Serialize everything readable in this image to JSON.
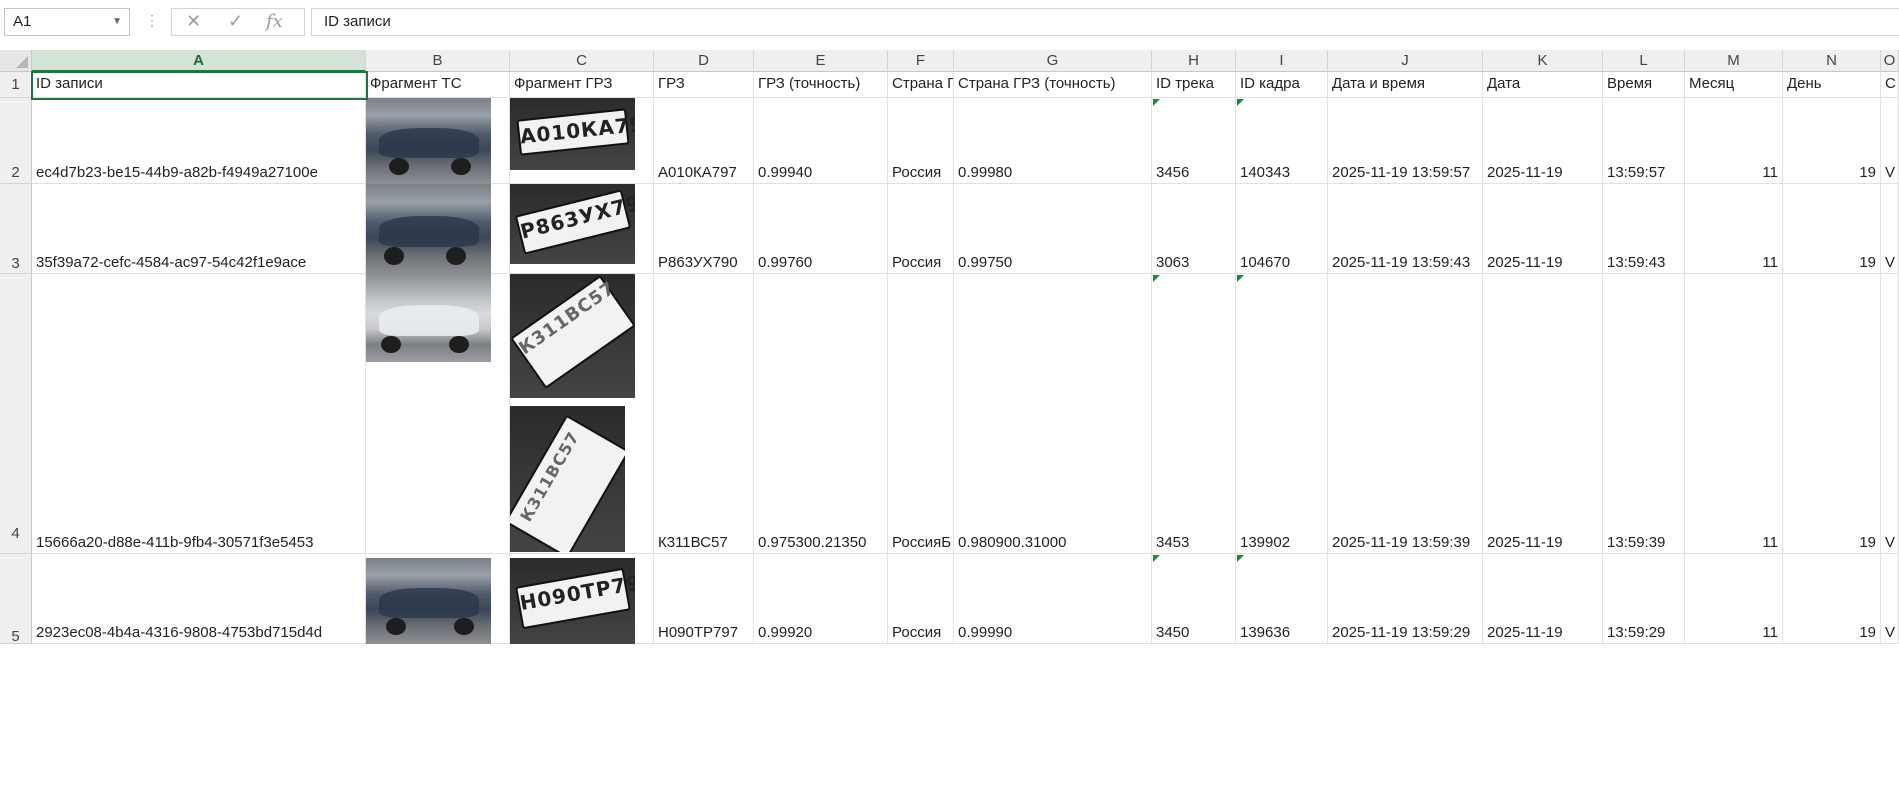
{
  "formula_bar": {
    "name_box": "A1",
    "fx_label": "fx",
    "cancel_glyph": "✕",
    "enter_glyph": "✓",
    "formula_value": "ID записи"
  },
  "columns": [
    "A",
    "B",
    "C",
    "D",
    "E",
    "F",
    "G",
    "H",
    "I",
    "J",
    "K",
    "L",
    "M",
    "N",
    "O"
  ],
  "row_numbers": [
    "1",
    "2",
    "3",
    "4",
    "5"
  ],
  "headers": {
    "A": "ID записи",
    "B": "Фрагмент ТС",
    "C": "Фрагмент ГРЗ",
    "D": "ГРЗ",
    "E": "ГРЗ (точность)",
    "F": "Страна ГРЗ",
    "G": "Страна ГРЗ (точность)",
    "H": "ID трека",
    "I": "ID кадра",
    "J": "Дата и время",
    "K": "Дата",
    "L": "Время",
    "M": "Месяц",
    "N": "День",
    "O": "С"
  },
  "rows": [
    {
      "A": "ec4d7b23-be15-44b9-a82b-f4949a27100e",
      "D": "А010КА797",
      "E": "0.99940",
      "F": "Россия",
      "G": "0.99980",
      "H": "3456",
      "I": "140343",
      "J": "2025-11-19 13:59:57",
      "K": "2025-11-19",
      "L": "13:59:57",
      "M": "11",
      "N": "19",
      "O": "V",
      "plate_text": "А010КА797"
    },
    {
      "A": "35f39a72-cefc-4584-ac97-54c42f1e9ace",
      "D": "Р863УХ790",
      "E": "0.99760",
      "F": "Россия",
      "G": "0.99750",
      "H": "3063",
      "I": "104670",
      "J": "2025-11-19 13:59:43",
      "K": "2025-11-19",
      "L": "13:59:43",
      "M": "11",
      "N": "19",
      "O": "V",
      "plate_text": "Р863УХ790"
    },
    {
      "A": "15666a20-d88e-411b-9fb4-30571f3e5453",
      "D": "К311ВС57",
      "E": "0.975300.21350",
      "F": "РоссияБ",
      "G": "0.980900.31000",
      "H": "3453",
      "I": "139902",
      "J": "2025-11-19 13:59:39",
      "K": "2025-11-19",
      "L": "13:59:39",
      "M": "11",
      "N": "19",
      "O": "V",
      "plate_text": "К311ВС57"
    },
    {
      "A": "2923ec08-4b4a-4316-9808-4753bd715d4d",
      "D": "Н090ТР797",
      "E": "0.99920",
      "F": "Россия",
      "G": "0.99990",
      "H": "3450",
      "I": "139636",
      "J": "2025-11-19 13:59:29",
      "K": "2025-11-19",
      "L": "13:59:29",
      "M": "11",
      "N": "19",
      "O": "V",
      "plate_text": "Н090ТР797"
    }
  ],
  "icons": {
    "name_box_dropdown": "chevron-down-icon",
    "formula_cancel": "close-icon",
    "formula_enter": "check-icon",
    "formula_function": "fx-icon"
  },
  "colors": {
    "selection": "#217346",
    "comment_marker": "#1a8a3a"
  }
}
